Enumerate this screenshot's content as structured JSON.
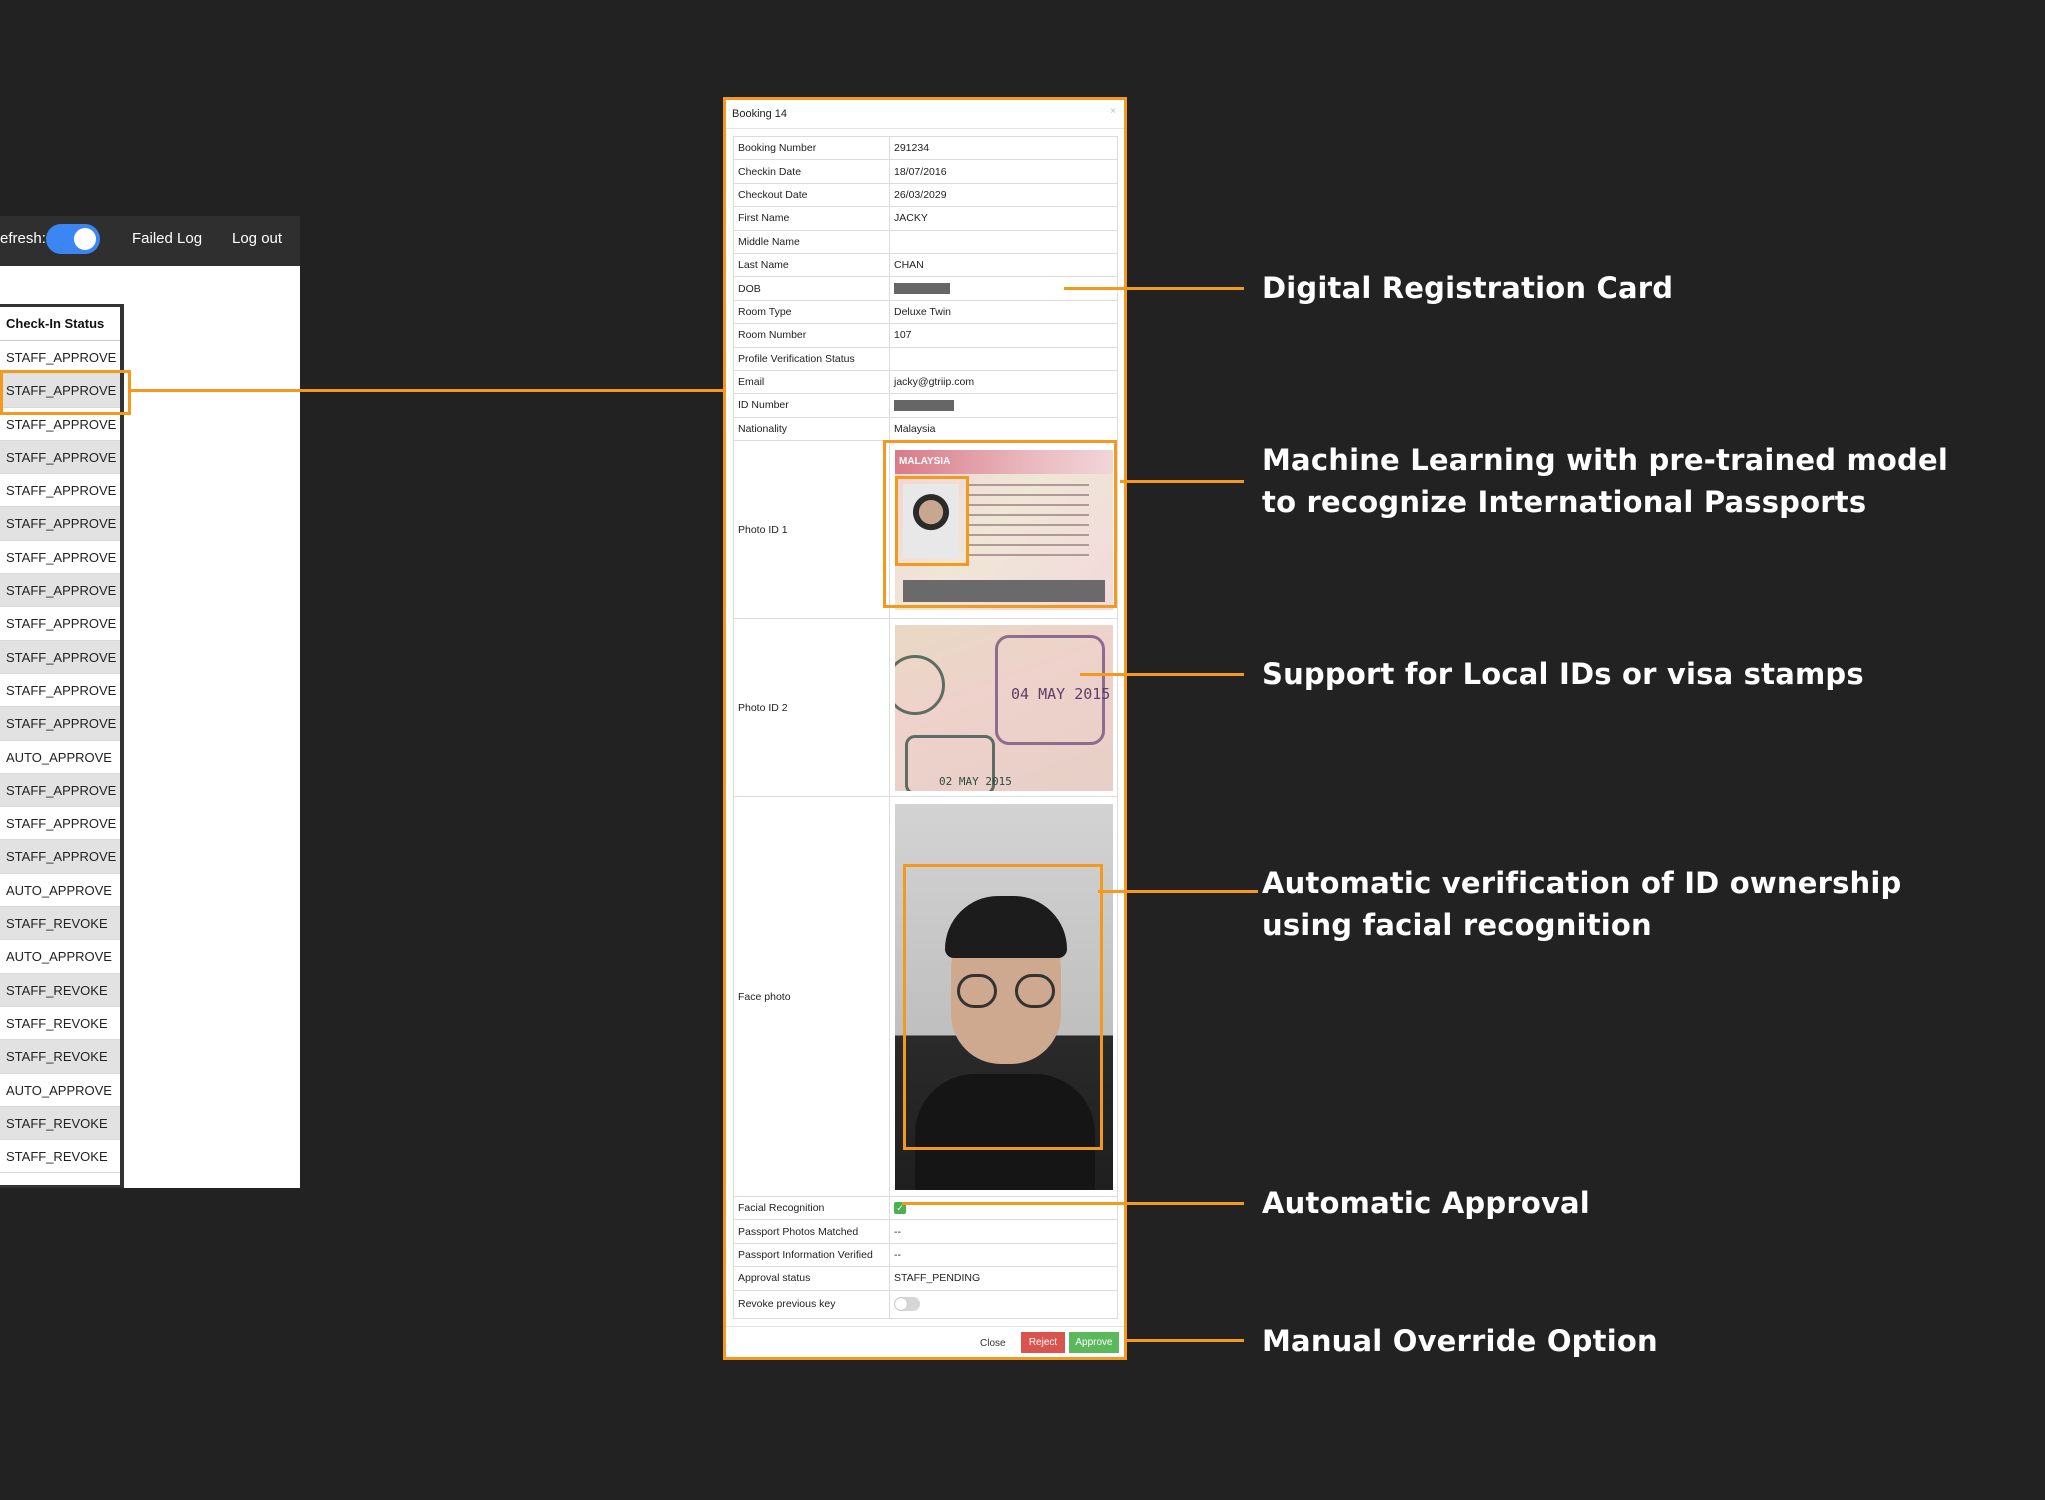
{
  "topbar": {
    "refresh_label": "efresh:",
    "failed_log": "Failed Log",
    "log_out": "Log out"
  },
  "checkin_list": {
    "header": "Check-In Status",
    "rows": [
      "STAFF_APPROVE",
      "STAFF_APPROVE",
      "STAFF_APPROVE",
      "STAFF_APPROVE",
      "STAFF_APPROVE",
      "STAFF_APPROVE",
      "STAFF_APPROVE",
      "STAFF_APPROVE",
      "STAFF_APPROVE",
      "STAFF_APPROVE",
      "STAFF_APPROVE",
      "STAFF_APPROVE",
      "AUTO_APPROVE",
      "STAFF_APPROVE",
      "STAFF_APPROVE",
      "STAFF_APPROVE",
      "AUTO_APPROVE",
      "STAFF_REVOKE",
      "AUTO_APPROVE",
      "STAFF_REVOKE",
      "STAFF_REVOKE",
      "STAFF_REVOKE",
      "AUTO_APPROVE",
      "STAFF_REVOKE",
      "STAFF_REVOKE"
    ]
  },
  "modal": {
    "title": "Booking 14",
    "close_x": "×",
    "fields": {
      "booking_number": {
        "label": "Booking Number",
        "value": "291234"
      },
      "checkin_date": {
        "label": "Checkin Date",
        "value": "18/07/2016"
      },
      "checkout_date": {
        "label": "Checkout Date",
        "value": "26/03/2029"
      },
      "first_name": {
        "label": "First Name",
        "value": "JACKY"
      },
      "middle_name": {
        "label": "Middle Name",
        "value": ""
      },
      "last_name": {
        "label": "Last Name",
        "value": "CHAN"
      },
      "dob": {
        "label": "DOB",
        "value": ""
      },
      "room_type": {
        "label": "Room Type",
        "value": "Deluxe Twin"
      },
      "room_number": {
        "label": "Room Number",
        "value": "107"
      },
      "profile_verification_status": {
        "label": "Profile Verification Status",
        "value": ""
      },
      "email": {
        "label": "Email",
        "value": "jacky@gtriip.com"
      },
      "id_number": {
        "label": "ID Number",
        "value": ""
      },
      "nationality": {
        "label": "Nationality",
        "value": "Malaysia"
      },
      "photo_id_1": {
        "label": "Photo ID 1"
      },
      "photo_id_2": {
        "label": "Photo ID 2"
      },
      "face_photo": {
        "label": "Face photo"
      },
      "facial_recognition": {
        "label": "Facial Recognition",
        "value": "✓"
      },
      "passport_photos_matched": {
        "label": "Passport Photos Matched",
        "value": "--"
      },
      "passport_information_verified": {
        "label": "Passport Information Verified",
        "value": "--"
      },
      "approval_status": {
        "label": "Approval status",
        "value": "STAFF_PENDING"
      },
      "revoke_previous_key": {
        "label": "Revoke previous key"
      }
    },
    "passport_country": "MALAYSIA",
    "stamp_date": "04 MAY 2015",
    "stamp_date2": "02 MAY 2015",
    "buttons": {
      "close": "Close",
      "reject": "Reject",
      "approve": "Approve"
    }
  },
  "annotations": {
    "digital_registration": "Digital Registration Card",
    "ml_line1": "Machine Learning with pre-trained model",
    "ml_line2": "to recognize International Passports",
    "local_ids": "Support for Local IDs or visa stamps",
    "face_line1": "Automatic verification of ID ownership",
    "face_line2": "using facial recognition",
    "auto_approval": "Automatic Approval",
    "manual_override": "Manual Override Option"
  },
  "colors": {
    "background": "#222222",
    "highlight": "#f39a1e",
    "toggle_on": "#3b86f2",
    "reject": "#d9534f",
    "approve": "#5cb85c"
  }
}
